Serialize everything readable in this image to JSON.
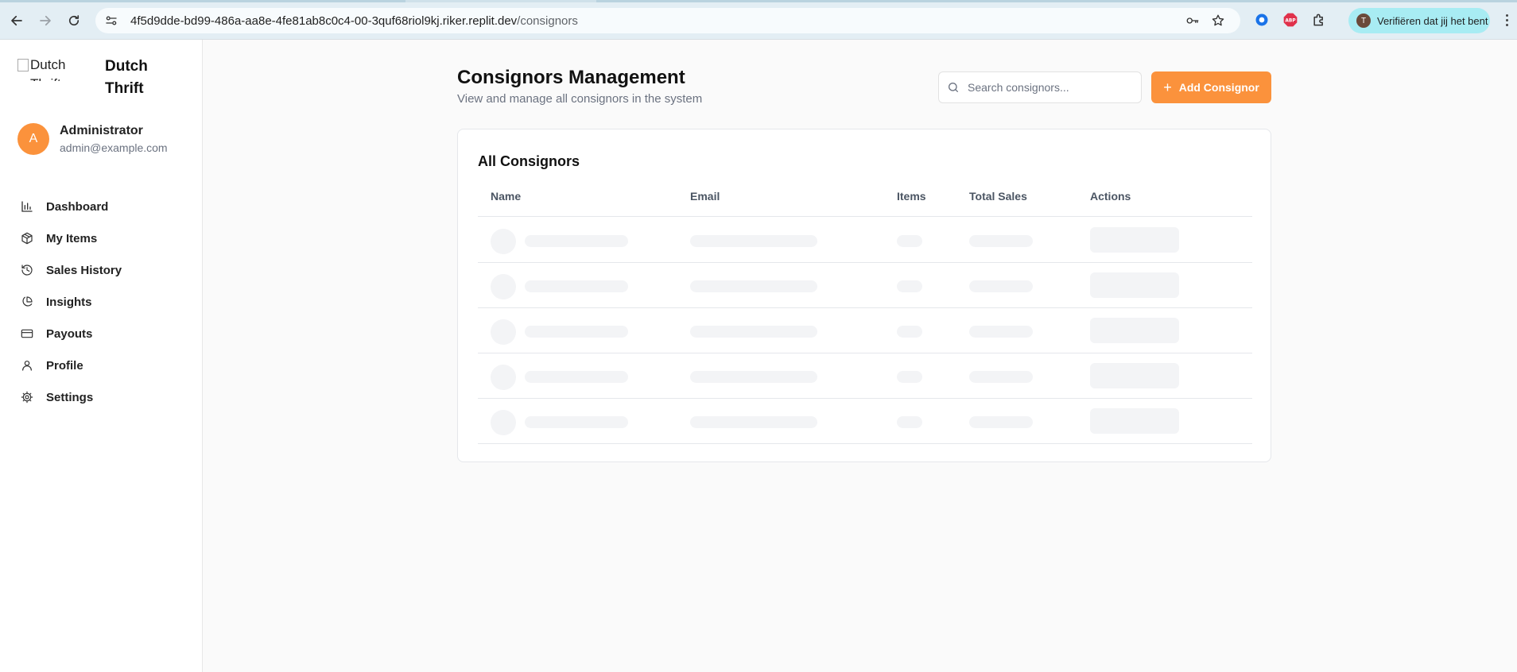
{
  "browser": {
    "url_host": "4f5d9dde-bd99-486a-aa8e-4fe81ab8c0c4-00-3quf68riol9kj.riker.replit.dev",
    "url_path": "/consignors",
    "profile_label": "Verifiëren dat jij het bent",
    "profile_initial": "T"
  },
  "sidebar": {
    "logo_alt": "Dutch Thrift",
    "brand_name": "Dutch Thrift",
    "user": {
      "initial": "A",
      "name": "Administrator",
      "email": "admin@example.com"
    },
    "items": [
      {
        "label": "Dashboard",
        "icon": "bar-chart-icon"
      },
      {
        "label": "My Items",
        "icon": "package-icon"
      },
      {
        "label": "Sales History",
        "icon": "history-icon"
      },
      {
        "label": "Insights",
        "icon": "pie-chart-icon"
      },
      {
        "label": "Payouts",
        "icon": "credit-card-icon"
      },
      {
        "label": "Profile",
        "icon": "user-icon"
      },
      {
        "label": "Settings",
        "icon": "gear-icon"
      }
    ]
  },
  "main": {
    "title": "Consignors Management",
    "subtitle": "View and manage all consignors in the system",
    "search_placeholder": "Search consignors...",
    "add_button": "Add Consignor",
    "card_title": "All Consignors",
    "columns": [
      "Name",
      "Email",
      "Items",
      "Total Sales",
      "Actions"
    ],
    "loading_rows": 5
  },
  "colors": {
    "accent": "#fb923c",
    "skeleton": "#f3f4f6"
  }
}
